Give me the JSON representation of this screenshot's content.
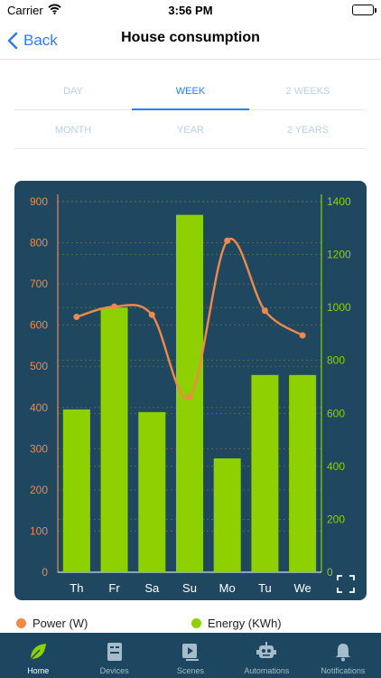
{
  "status": {
    "carrier": "Carrier",
    "time": "3:56 PM"
  },
  "nav": {
    "back_label": "Back",
    "title": "House consumption"
  },
  "periods": {
    "row1": [
      "DAY",
      "WEEK",
      "2 WEEKS"
    ],
    "row2": [
      "MONTH",
      "YEAR",
      "2 YEARS"
    ],
    "selected": "WEEK"
  },
  "colors": {
    "accent": "#2f7cf6",
    "power": "#f0894a",
    "energy": "#8fd100",
    "card": "#1f4760",
    "tabbar": "#1d4660"
  },
  "chart_data": {
    "type": "bar",
    "categories": [
      "Th",
      "Fr",
      "Sa",
      "Su",
      "Mo",
      "Tu",
      "We"
    ],
    "series": [
      {
        "name": "Energy (KWh)",
        "type": "bar",
        "axis": "right",
        "values": [
          615,
          1000,
          605,
          1350,
          430,
          745,
          745
        ]
      },
      {
        "name": "Power (W)",
        "type": "line",
        "axis": "left",
        "values": [
          620,
          645,
          625,
          425,
          805,
          635,
          575
        ]
      }
    ],
    "y_left": {
      "ticks": [
        0,
        100,
        200,
        300,
        400,
        500,
        600,
        700,
        800,
        900
      ],
      "ylim": [
        0,
        900
      ]
    },
    "y_right": {
      "ticks": [
        0,
        200,
        400,
        600,
        800,
        1000,
        1200,
        1400
      ],
      "ylim": [
        0,
        1400
      ]
    },
    "grid": true,
    "legend": "bottom"
  },
  "legend": {
    "power": "Power (W)",
    "energy": "Energy (KWh)"
  },
  "tabbar": [
    {
      "label": "Home",
      "icon": "leaf-icon",
      "active": true
    },
    {
      "label": "Devices",
      "icon": "device-icon",
      "active": false
    },
    {
      "label": "Scenes",
      "icon": "scenes-icon",
      "active": false
    },
    {
      "label": "Automations",
      "icon": "robot-icon",
      "active": false
    },
    {
      "label": "Notifications",
      "icon": "bell-icon",
      "active": false
    }
  ]
}
